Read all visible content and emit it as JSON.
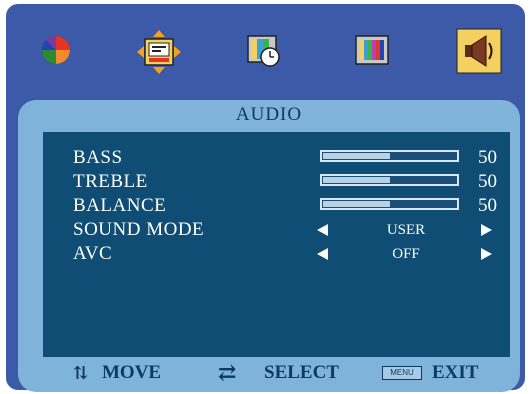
{
  "icons": [
    "color-wheel-icon",
    "position-icon",
    "clock-icon",
    "color-bars-icon",
    "speaker-icon"
  ],
  "colors": {
    "frame": "#3d5aa9",
    "panel": "#80b3d9",
    "menu_area": "#0f4d74",
    "selected_tab": "#f3d060"
  },
  "audio": {
    "title": "AUDIO",
    "items": [
      {
        "label": "BASS",
        "value": "50",
        "level": 0.5
      },
      {
        "label": "TREBLE",
        "value": "50",
        "level": 0.5
      },
      {
        "label": "BALANCE",
        "value": "50",
        "level": 0.5
      }
    ],
    "options": [
      {
        "label": "SOUND MODE",
        "value": "USER"
      },
      {
        "label": "AVC",
        "value": "OFF"
      }
    ]
  },
  "footer": {
    "move": "MOVE",
    "select": "SELECT",
    "menu_key": "MENU",
    "exit": "EXIT"
  }
}
